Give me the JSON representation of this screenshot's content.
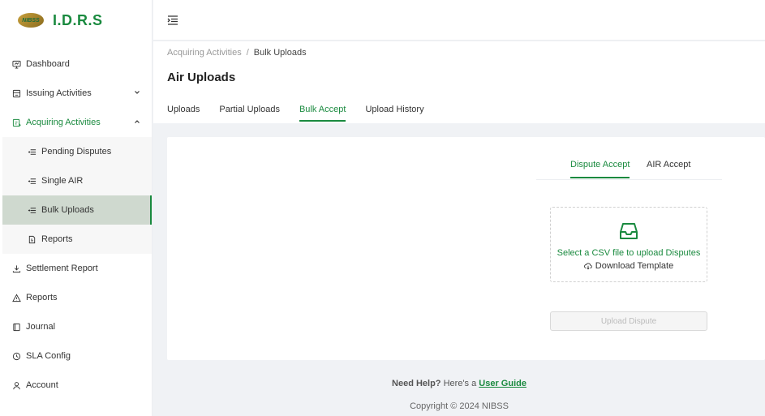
{
  "brand": {
    "logo_mark": "NIBSS",
    "name": "I.D.R.S"
  },
  "sidebar": {
    "items": [
      {
        "label": "Dashboard",
        "icon": "dashboard-icon"
      },
      {
        "label": "Issuing Activities",
        "icon": "issuing-icon"
      },
      {
        "label": "Acquiring Activities",
        "icon": "acquiring-icon"
      },
      {
        "label": "Settlement Report",
        "icon": "download-icon"
      },
      {
        "label": "Reports",
        "icon": "warning-icon"
      },
      {
        "label": "Journal",
        "icon": "journal-icon"
      },
      {
        "label": "SLA Config",
        "icon": "clock-icon"
      },
      {
        "label": "Account",
        "icon": "user-icon"
      }
    ],
    "acquiring_sub": [
      {
        "label": "Pending Disputes",
        "icon": "list-icon"
      },
      {
        "label": "Single AIR",
        "icon": "list-icon"
      },
      {
        "label": "Bulk Uploads",
        "icon": "list-icon"
      },
      {
        "label": "Reports",
        "icon": "report-icon"
      }
    ]
  },
  "breadcrumb": {
    "parent": "Acquiring Activities",
    "separator": "/",
    "current": "Bulk Uploads"
  },
  "page_title": "Air Uploads",
  "tabs": [
    "Uploads",
    "Partial Uploads",
    "Bulk Accept",
    "Upload History"
  ],
  "active_tab": "Bulk Accept",
  "subtabs": [
    "Dispute Accept",
    "AIR Accept"
  ],
  "active_subtab": "Dispute Accept",
  "dropzone": {
    "text": "Select a CSV file to upload Disputes",
    "template_link": "Download Template"
  },
  "upload_button": "Upload Dispute",
  "footer": {
    "help_prefix": "Need Help?",
    "help_mid": "Here's a",
    "help_link": "User Guide",
    "copyright": "Copyright © 2024 NIBSS"
  },
  "colors": {
    "accent": "#1a8a3f",
    "selected_bg": "#cfd9cf",
    "content_bg": "#f0f2f5"
  }
}
